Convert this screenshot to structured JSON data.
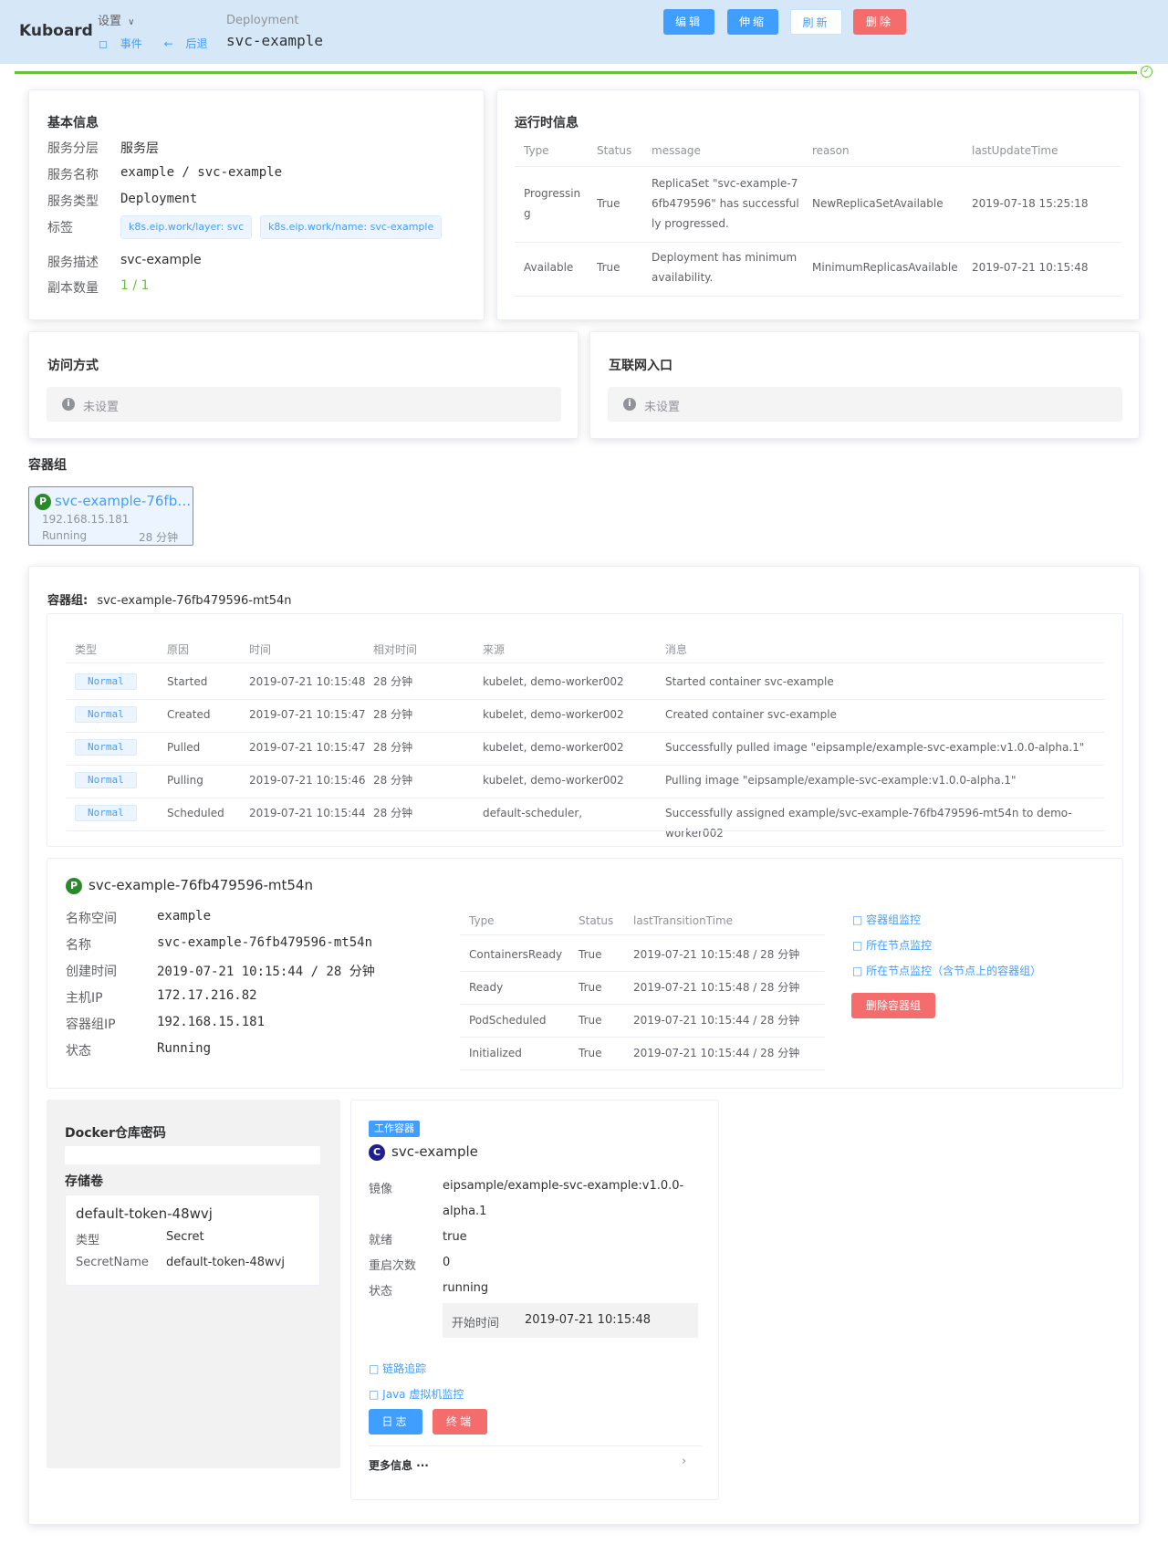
{
  "header": {
    "brand": "Kuboard",
    "settings": "设置",
    "events_link": "事件",
    "back_link": "后退",
    "kind": "Deployment",
    "name": "svc-example",
    "buttons": {
      "edit": "编辑",
      "scale": "伸缩",
      "refresh": "刷新",
      "delete": "删除"
    }
  },
  "basic": {
    "title": "基本信息",
    "layer_label": "服务分层",
    "layer_value": "服务层",
    "name_label": "服务名称",
    "name_value": "example / svc-example",
    "type_label": "服务类型",
    "type_value": "Deployment",
    "tags_label": "标签",
    "tags": [
      "k8s.eip.work/layer: svc",
      "k8s.eip.work/name: svc-example"
    ],
    "desc_label": "服务描述",
    "desc_value": "svc-example",
    "replicas_label": "副本数量",
    "replicas_value": "1 / 1"
  },
  "runtime": {
    "title": "运行时信息",
    "headers": [
      "Type",
      "Status",
      "message",
      "reason",
      "lastUpdateTime"
    ],
    "rows": [
      {
        "type": "Progressing",
        "status": "True",
        "message": "ReplicaSet \"svc-example-76fb479596\" has successfully progressed.",
        "reason": "NewReplicaSetAvailable",
        "time": "2019-07-18 15:25:18"
      },
      {
        "type": "Available",
        "status": "True",
        "message": "Deployment has minimum availability.",
        "reason": "MinimumReplicasAvailable",
        "time": "2019-07-21 10:15:48"
      }
    ]
  },
  "access": {
    "title": "访问方式",
    "empty": "未设置"
  },
  "ingress": {
    "title": "互联网入口",
    "empty": "未设置"
  },
  "pods": {
    "title": "容器组",
    "pod": {
      "badge": "P",
      "name": "svc-example-76fb…",
      "ip": "192.168.15.181",
      "status": "Running",
      "age": "28 分钟"
    }
  },
  "pod_detail": {
    "title_prefix": "容器组:",
    "title_name": "svc-example-76fb479596-mt54n",
    "events_headers": [
      "类型",
      "原因",
      "时间",
      "相对时间",
      "来源",
      "消息"
    ],
    "events": [
      {
        "type": "Normal",
        "reason": "Started",
        "time": "2019-07-21 10:15:48",
        "rel": "28 分钟",
        "source": "kubelet, demo-worker002",
        "message": "Started container svc-example"
      },
      {
        "type": "Normal",
        "reason": "Created",
        "time": "2019-07-21 10:15:47",
        "rel": "28 分钟",
        "source": "kubelet, demo-worker002",
        "message": "Created container svc-example"
      },
      {
        "type": "Normal",
        "reason": "Pulled",
        "time": "2019-07-21 10:15:47",
        "rel": "28 分钟",
        "source": "kubelet, demo-worker002",
        "message": "Successfully pulled image \"eipsample/example-svc-example:v1.0.0-alpha.1\""
      },
      {
        "type": "Normal",
        "reason": "Pulling",
        "time": "2019-07-21 10:15:46",
        "rel": "28 分钟",
        "source": "kubelet, demo-worker002",
        "message": "Pulling image \"eipsample/example-svc-example:v1.0.0-alpha.1\""
      },
      {
        "type": "Normal",
        "reason": "Scheduled",
        "time": "2019-07-21 10:15:44",
        "rel": "28 分钟",
        "source": "default-scheduler,",
        "message": "Successfully assigned example/svc-example-76fb479596-mt54n to demo-worker002"
      }
    ],
    "info": {
      "badge": "P",
      "name": "svc-example-76fb479596-mt54n",
      "fields": [
        {
          "label": "名称空间",
          "value": "example"
        },
        {
          "label": "名称",
          "value": "svc-example-76fb479596-mt54n"
        },
        {
          "label": "创建时间",
          "value": "2019-07-21 10:15:44 / 28 分钟"
        },
        {
          "label": "主机IP",
          "value": "172.17.216.82"
        },
        {
          "label": "容器组IP",
          "value": "192.168.15.181"
        },
        {
          "label": "状态",
          "value": "Running"
        }
      ],
      "cond_headers": [
        "Type",
        "Status",
        "lastTransitionTime"
      ],
      "conditions": [
        {
          "type": "ContainersReady",
          "status": "True",
          "time": "2019-07-21 10:15:48 / 28 分钟"
        },
        {
          "type": "Ready",
          "status": "True",
          "time": "2019-07-21 10:15:48 / 28 分钟"
        },
        {
          "type": "PodScheduled",
          "status": "True",
          "time": "2019-07-21 10:15:44 / 28 分钟"
        },
        {
          "type": "Initialized",
          "status": "True",
          "time": "2019-07-21 10:15:44 / 28 分钟"
        }
      ],
      "links": [
        "容器组监控",
        "所在节点监控",
        "所在节点监控（含节点上的容器组）"
      ],
      "delete_button": "删除容器组"
    }
  },
  "volumes": {
    "docker_title": "Docker仓库密码",
    "storage_title": "存储卷",
    "volume_name": "default-token-48wvj",
    "type_label": "类型",
    "type_value": "Secret",
    "secret_label": "SecretName",
    "secret_value": "default-token-48wvj"
  },
  "container": {
    "tag": "工作容器",
    "badge": "C",
    "name": "svc-example",
    "image_label": "镜像",
    "image_value_1": "eipsample/example-svc-example:v1.0.0-",
    "image_value_2": "alpha.1",
    "ready_label": "就绪",
    "ready_value": "true",
    "restarts_label": "重启次数",
    "restarts_value": "0",
    "state_label": "状态",
    "state_value": "running",
    "start_label": "开始时间",
    "start_value": "2019-07-21 10:15:48",
    "trace_link": "链路追踪",
    "jvm_link": "Java 虚拟机监控",
    "log_button": "日志",
    "terminal_button": "终端",
    "more": "更多信息 ···"
  }
}
